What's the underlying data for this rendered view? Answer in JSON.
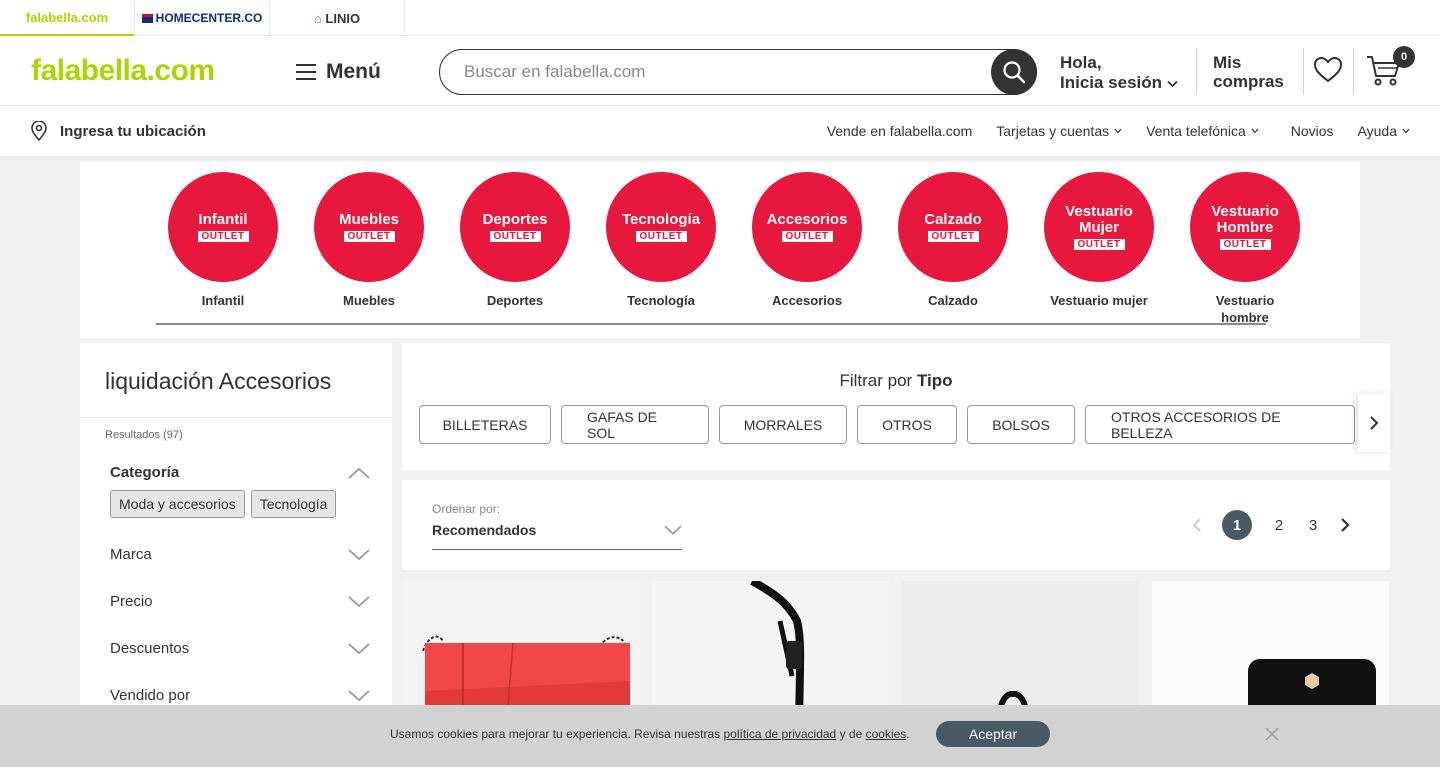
{
  "brands": [
    {
      "label": "falabella.com",
      "active": true
    },
    {
      "label": "HOMECENTER.CO"
    },
    {
      "label": "LINIO"
    }
  ],
  "header": {
    "logo": "falabella.com",
    "menu_label": "Menú",
    "search_placeholder": "Buscar en falabella.com",
    "greeting": "Hola,",
    "login_label": "Inicia sesión",
    "orders_line1": "Mis",
    "orders_line2": "compras",
    "cart_count": "0"
  },
  "location": {
    "label": "Ingresa tu ubicación"
  },
  "top_links": [
    {
      "label": "Vende en falabella.com"
    },
    {
      "label": "Tarjetas y cuentas"
    },
    {
      "label": "Venta telefónica"
    },
    {
      "label": "Novios"
    },
    {
      "label": "Ayuda"
    }
  ],
  "outlet_categories": [
    {
      "circle_text": "Infantil",
      "badge": "OUTLET",
      "label": "Infantil"
    },
    {
      "circle_text": "Muebles",
      "badge": "OUTLET",
      "label": "Muebles"
    },
    {
      "circle_text": "Deportes",
      "badge": "OUTLET",
      "label": "Deportes"
    },
    {
      "circle_text": "Tecnología",
      "badge": "OUTLET",
      "label": "Tecnología"
    },
    {
      "circle_text": "Accesorios",
      "badge": "OUTLET",
      "label": "Accesorios"
    },
    {
      "circle_text": "Calzado",
      "badge": "OUTLET",
      "label": "Calzado"
    },
    {
      "circle_text": "Vestuario Mujer",
      "badge": "OUTLET",
      "label": "Vestuario mujer"
    },
    {
      "circle_text": "Vestuario Hombre",
      "badge": "OUTLET",
      "label": "Vestuario hombre"
    }
  ],
  "sidebar": {
    "title": "liquidación Accesorios",
    "results": "Resultados (97)",
    "category_label": "Categoría",
    "category_chips": [
      "Moda y accesorios",
      "Tecnología"
    ],
    "facets": [
      "Marca",
      "Precio",
      "Descuentos",
      "Vendido por"
    ]
  },
  "type_filter": {
    "title_prefix": "Filtrar por",
    "title_bold": "Tipo",
    "options": [
      "BILLETERAS",
      "GAFAS DE SOL",
      "MORRALES",
      "OTROS",
      "BOLSOS",
      "OTROS ACCESORIOS DE BELLEZA"
    ]
  },
  "sort": {
    "label": "Ordenar por:",
    "value": "Recomendados"
  },
  "pagination": {
    "current": "1",
    "pages": [
      "2",
      "3"
    ]
  },
  "cookie": {
    "text_before": "Usamos cookies para mejorar tu experiencia. Revisa nuestras",
    "privacy_link": "política de privacidad",
    "text_middle": "y de",
    "cookies_link": "cookies",
    "text_after": ".",
    "accept_label": "Aceptar"
  },
  "colors": {
    "brand_green": "#aad500",
    "outlet_red": "#e8173e",
    "dark": "#333333",
    "accent_slate": "#4a5a64"
  }
}
